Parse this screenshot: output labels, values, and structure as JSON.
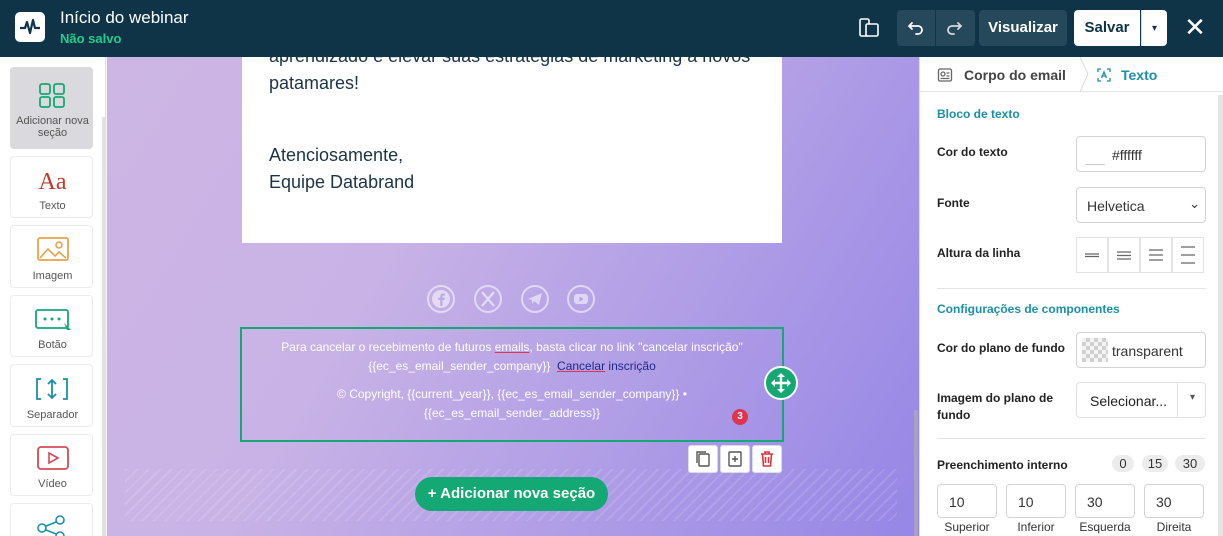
{
  "header": {
    "title": "Início do webinar",
    "status": "Não salvo",
    "preview_label": "Visualizar",
    "save_label": "Salvar"
  },
  "sidebar": {
    "items": [
      {
        "label": "Adicionar nova seção",
        "icon": "grid-icon"
      },
      {
        "label": "Texto",
        "icon": "text-aa-icon"
      },
      {
        "label": "Imagem",
        "icon": "image-icon"
      },
      {
        "label": "Botão",
        "icon": "button-icon"
      },
      {
        "label": "Separador",
        "icon": "separator-icon"
      },
      {
        "label": "Vídeo",
        "icon": "video-icon"
      },
      {
        "label": "",
        "icon": "share-icon"
      }
    ]
  },
  "canvas": {
    "body_partial": "aprendizado e elevar suas estratégias de marketing a novos",
    "body_partial_2": "patamares!",
    "signoff": "Atenciosamente,",
    "signature": "Equipe Databrand",
    "footer": {
      "line1_a": "Para cancelar o recebimento de futuros ",
      "line1_b": "emails",
      "line1_c": ", basta clicar no link \"cancelar inscrição\"",
      "line2_a": "{{ec_es_email_sender_company}}",
      "line2_link_a": "Cancelar",
      "line2_link_b": " inscrição",
      "line3": "© Copyright, {{current_year}}, {{ec_es_email_sender_company}} •",
      "line4": "{{ec_es_email_sender_address}}"
    },
    "badge_count": "3",
    "add_section_label": "+ Adicionar nova seção"
  },
  "panel": {
    "breadcrumb": [
      "Corpo do email",
      "Texto"
    ],
    "text_block_title": "Bloco de texto",
    "text_color_label": "Cor do texto",
    "text_color_value": "#ffffff",
    "font_label": "Fonte",
    "font_value": "Helvetica",
    "line_height_label": "Altura da linha",
    "component_settings_title": "Configurações de componentes",
    "bg_color_label": "Cor do plano de fundo",
    "bg_color_value": "transparent",
    "bg_image_label": "Imagem do plano de fundo",
    "bg_image_select": "Selecionar...",
    "padding_label": "Preenchimento interno",
    "padding_presets": [
      "0",
      "15",
      "30"
    ],
    "padding_values": [
      "10",
      "10",
      "30",
      "30"
    ],
    "padding_labels": [
      "Superior",
      "Inferior",
      "Esquerda",
      "Direita"
    ]
  },
  "colors": {
    "accent": "#13a874",
    "header_bg": "#0f3447",
    "panel_accent": "#1a8fa8",
    "badge": "#e2334e"
  }
}
